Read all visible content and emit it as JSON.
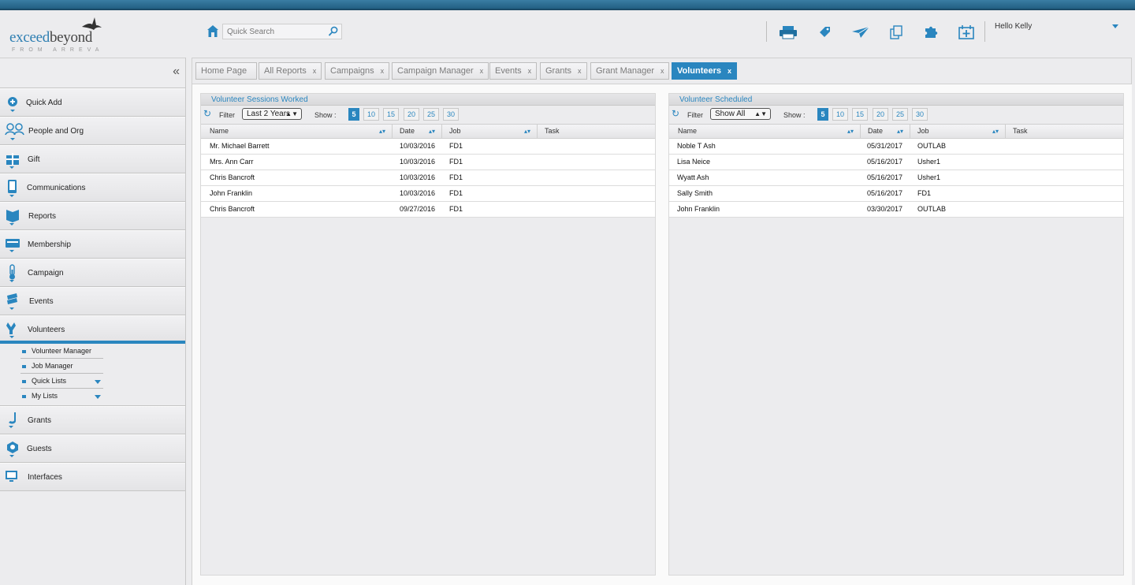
{
  "header": {
    "logo_text_1": "exceed",
    "logo_text_2": "beyond",
    "logo_sub": "FROM ARREVA",
    "search_placeholder": "Quick Search",
    "greeting": "Hello Kelly"
  },
  "sidebar": {
    "collapse_label": "«",
    "items": [
      {
        "label": "Quick Add"
      },
      {
        "label": "People and Org"
      },
      {
        "label": "Gift"
      },
      {
        "label": "Communications"
      },
      {
        "label": "Reports"
      },
      {
        "label": "Membership"
      },
      {
        "label": "Campaign"
      },
      {
        "label": "Events"
      },
      {
        "label": "Volunteers"
      },
      {
        "label": "Grants"
      },
      {
        "label": "Guests"
      },
      {
        "label": "Interfaces"
      }
    ],
    "subitems": [
      {
        "label": "Volunteer Manager"
      },
      {
        "label": "Job Manager"
      },
      {
        "label": "Quick Lists"
      },
      {
        "label": "My Lists"
      }
    ]
  },
  "tabs": [
    {
      "label": "Home Page"
    },
    {
      "label": "All Reports"
    },
    {
      "label": "Campaigns"
    },
    {
      "label": "Campaign Manager"
    },
    {
      "label": "Events"
    },
    {
      "label": "Grants"
    },
    {
      "label": "Grant Manager"
    },
    {
      "label": "Volunteers"
    }
  ],
  "tab_close": "x",
  "panels": {
    "worked": {
      "title": "Volunteer Sessions Worked",
      "filter_label": "Filter",
      "filter_value": "Last 2 Years",
      "show_label": "Show :",
      "page_sizes": [
        "5",
        "10",
        "15",
        "20",
        "25",
        "30"
      ],
      "columns": [
        "Name",
        "Date",
        "Job",
        "Task"
      ],
      "rows": [
        {
          "name": "Mr. Michael Barrett",
          "date": "10/03/2016",
          "job": "FD1",
          "task": ""
        },
        {
          "name": "Mrs. Ann Carr",
          "date": "10/03/2016",
          "job": "FD1",
          "task": ""
        },
        {
          "name": "Chris Bancroft",
          "date": "10/03/2016",
          "job": "FD1",
          "task": ""
        },
        {
          "name": "John Franklin",
          "date": "10/03/2016",
          "job": "FD1",
          "task": ""
        },
        {
          "name": "Chris Bancroft",
          "date": "09/27/2016",
          "job": "FD1",
          "task": ""
        }
      ]
    },
    "scheduled": {
      "title": "Volunteer Scheduled",
      "filter_label": "Filter",
      "filter_value": "Show All",
      "show_label": "Show :",
      "page_sizes": [
        "5",
        "10",
        "15",
        "20",
        "25",
        "30"
      ],
      "columns": [
        "Name",
        "Date",
        "Job",
        "Task"
      ],
      "rows": [
        {
          "name": "Noble T Ash",
          "date": "05/31/2017",
          "job": "OUTLAB",
          "task": ""
        },
        {
          "name": "Lisa Neice",
          "date": "05/16/2017",
          "job": "Usher1",
          "task": ""
        },
        {
          "name": "Wyatt Ash",
          "date": "05/16/2017",
          "job": "Usher1",
          "task": ""
        },
        {
          "name": "Sally Smith",
          "date": "05/16/2017",
          "job": "FD1",
          "task": ""
        },
        {
          "name": "John Franklin",
          "date": "03/30/2017",
          "job": "OUTLAB",
          "task": ""
        }
      ]
    }
  },
  "colors": {
    "accent": "#2a86bf",
    "topbar": "#2a6a90"
  }
}
